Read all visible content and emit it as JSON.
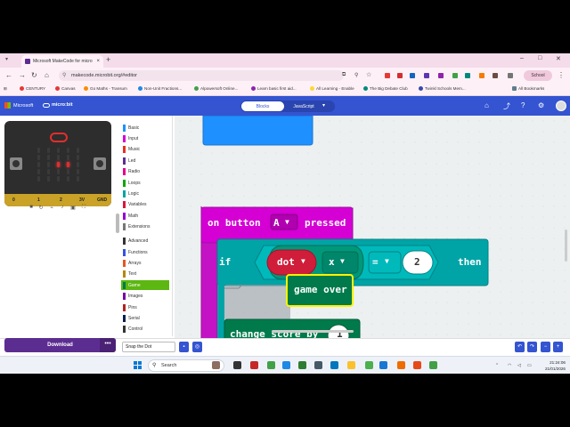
{
  "browser": {
    "tab_title": "Microsoft MakeCode for micro",
    "tab_close": "×",
    "new_tab": "+",
    "url": "makecode.microbit.org/#editor",
    "profile_label": "School"
  },
  "bookmarks": [
    {
      "label": "CENTURY",
      "color": "#e53935"
    },
    {
      "label": "Canvas",
      "color": "#e53935"
    },
    {
      "label": "Go Maths - Transum",
      "color": "#fb8c00"
    },
    {
      "label": "Non-Unit Fractions...",
      "color": "#1e88e5"
    },
    {
      "label": "Alpowersoft Online...",
      "color": "#43a047"
    },
    {
      "label": "Learn basic first aid...",
      "color": "#8e24aa"
    },
    {
      "label": "All Learning - Enable",
      "color": "#fdd835"
    },
    {
      "label": "The Big Debate Club",
      "color": "#00897b"
    },
    {
      "label": "Twinkl Schools Mem...",
      "color": "#3949ab"
    },
    {
      "label": "All Bookmarks",
      "color": "#607d8b"
    }
  ],
  "makecode": {
    "ms_label": "Microsoft",
    "product_label": "micro:bit",
    "mode_blocks": "Blocks",
    "mode_js": "JavaScript",
    "mode_chevron": "▾"
  },
  "simulator": {
    "pins": [
      "0",
      "1",
      "2",
      "3V",
      "GND"
    ],
    "button_a": "A",
    "button_b": "B",
    "lit_leds": [
      [
        2,
        2
      ],
      [
        2,
        3
      ]
    ]
  },
  "toolbox": {
    "items": [
      {
        "label": "Basic",
        "color": "#1e90ff"
      },
      {
        "label": "Input",
        "color": "#d400d4"
      },
      {
        "label": "Music",
        "color": "#e63022"
      },
      {
        "label": "Led",
        "color": "#5c2d91"
      },
      {
        "label": "Radio",
        "color": "#e3008c"
      },
      {
        "label": "Loops",
        "color": "#00aa00"
      },
      {
        "label": "Logic",
        "color": "#00a4a6"
      },
      {
        "label": "Variables",
        "color": "#dc143c"
      },
      {
        "label": "Math",
        "color": "#9400d3"
      },
      {
        "label": "Extensions",
        "color": "#777777"
      },
      {
        "label": "Advanced",
        "color": "#333333"
      },
      {
        "label": "Functions",
        "color": "#3455db"
      },
      {
        "label": "Arrays",
        "color": "#e65722"
      },
      {
        "label": "Text",
        "color": "#b8860b"
      },
      {
        "label": "Game",
        "color": "#007a4b"
      },
      {
        "label": "Images",
        "color": "#7600a8"
      },
      {
        "label": "Pins",
        "color": "#b22222"
      },
      {
        "label": "Serial",
        "color": "#002050"
      },
      {
        "label": "Control",
        "color": "#333333"
      }
    ],
    "selected": "Game"
  },
  "workspace": {
    "event_label": "on button",
    "event_button": "A",
    "event_suffix": "pressed",
    "if_label": "if",
    "sprite_var": "dot",
    "axis": "x",
    "operator": "=",
    "compare_value": "2",
    "then_label": "then",
    "floating_block": "game over",
    "change_label": "change score by",
    "change_value": "1",
    "dropdown_arrow": "▼",
    "plus_icon": "+"
  },
  "footer": {
    "download_label": "Download",
    "download_more": "•••",
    "project_name": "Snap the Dot"
  },
  "taskbar": {
    "search_label": "Search",
    "time": "21:24:06",
    "date": "21/01/2026"
  }
}
